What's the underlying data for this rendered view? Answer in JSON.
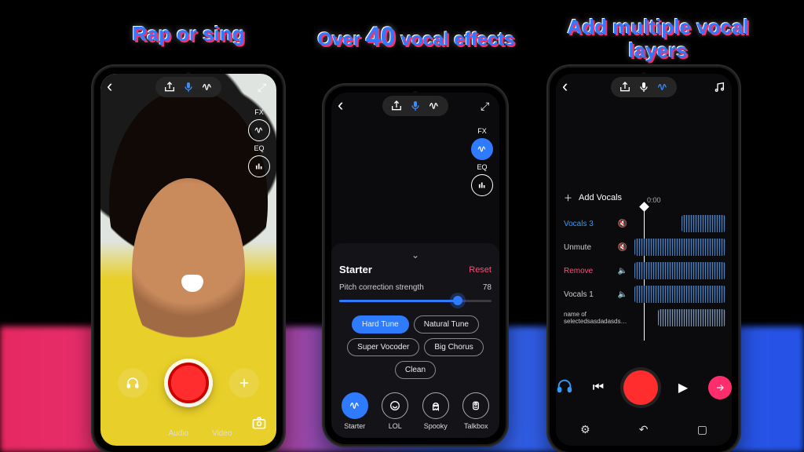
{
  "headlines": {
    "h1": "Rap or sing",
    "h2a": "Over ",
    "h2b": "40",
    "h2c": " vocal effects",
    "h3": "Add multiple vocal layers"
  },
  "sidebar": {
    "fx": "FX",
    "eq": "EQ"
  },
  "phone1": {
    "bottom_tabs": [
      "",
      "Audio",
      "Video"
    ],
    "head_btn": "headphones-icon",
    "plus_btn": "plus-icon"
  },
  "phone2": {
    "drawer_title": "Starter",
    "reset": "Reset",
    "slider_label": "Pitch correction strength",
    "slider_value": "78",
    "chips": [
      "Hard Tune",
      "Natural Tune",
      "Super Vocoder",
      "Big Chorus",
      "Clean"
    ],
    "active_chip": "Hard Tune",
    "presets": [
      "Starter",
      "LOL",
      "Spooky",
      "Talkbox"
    ],
    "active_preset": "Starter"
  },
  "phone3": {
    "add_vocals": "Add Vocals",
    "time0": "0:00",
    "layers": [
      {
        "label": "Vocals 3",
        "kind": "sel"
      },
      {
        "label": "Unmute",
        "kind": ""
      },
      {
        "label": "Remove",
        "kind": "rem"
      },
      {
        "label": "Vocals 1",
        "kind": ""
      },
      {
        "label": "name of selectedsasdadasds…",
        "kind": "gray"
      }
    ]
  },
  "icons": {
    "mic": "mic-icon",
    "wave": "wave-icon",
    "share": "share-icon",
    "expand": "expand-icon",
    "back": "back-icon"
  }
}
